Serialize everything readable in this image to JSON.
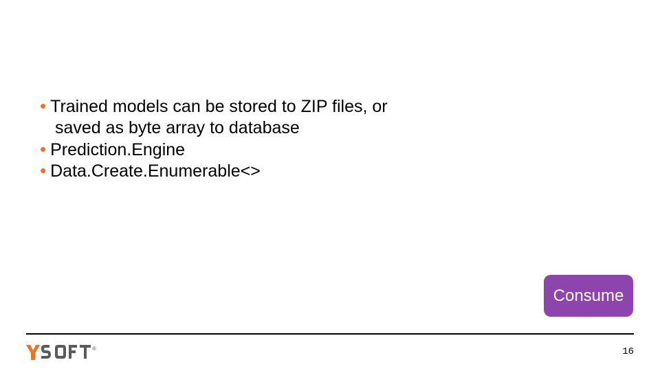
{
  "bullets": {
    "b1_line1": "Trained models can be stored to ZIP files, or",
    "b1_line2": "saved as byte array to database",
    "b2": "Prediction.Engine",
    "b3": "Data.Create.Enumerable<>"
  },
  "badge": {
    "label": "Consume",
    "color": "#8e44ad"
  },
  "footer": {
    "page_number": "16",
    "brand": "YSOFT"
  },
  "colors": {
    "accent": "#f37021"
  }
}
